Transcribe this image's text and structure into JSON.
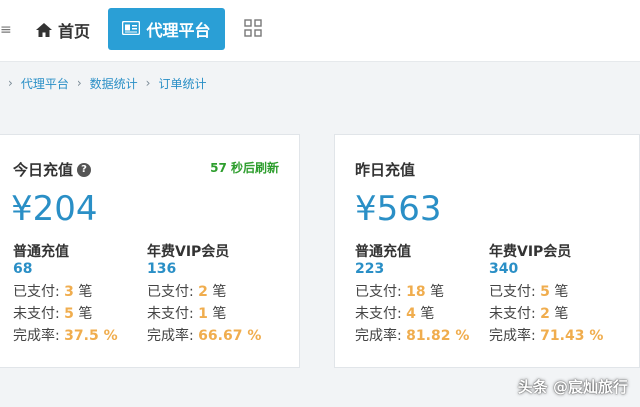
{
  "nav": {
    "home_label": "首页",
    "active_label": "代理平台",
    "edge_glyph": "≡"
  },
  "breadcrumb": {
    "items": [
      "代理平台",
      "数据统计",
      "订单统计"
    ],
    "separator": "›"
  },
  "today": {
    "title": "今日充值",
    "refresh_seconds": "57",
    "refresh_text": "秒后刷新",
    "amount": "¥204",
    "normal": {
      "name": "普通充值",
      "count": "68",
      "paid_label": "已支付: ",
      "paid": "3",
      "paid_unit": " 笔",
      "unpaid_label": "未支付: ",
      "unpaid": "5",
      "unpaid_unit": " 笔",
      "rate_label": "完成率: ",
      "rate": "37.5 %"
    },
    "vip": {
      "name": "年费VIP会员",
      "count": "136",
      "paid_label": "已支付: ",
      "paid": "2",
      "paid_unit": " 笔",
      "unpaid_label": "未支付: ",
      "unpaid": "1",
      "unpaid_unit": " 笔",
      "rate_label": "完成率: ",
      "rate": "66.67 %"
    }
  },
  "yesterday": {
    "title": "昨日充值",
    "amount": "¥563",
    "normal": {
      "name": "普通充值",
      "count": "223",
      "paid_label": "已支付: ",
      "paid": "18",
      "paid_unit": " 笔",
      "unpaid_label": "未支付: ",
      "unpaid": "4",
      "unpaid_unit": " 笔",
      "rate_label": "完成率: ",
      "rate": "81.82 %"
    },
    "vip": {
      "name": "年费VIP会员",
      "count": "340",
      "paid_label": "已支付: ",
      "paid": "5",
      "paid_unit": " 笔",
      "unpaid_label": "未支付: ",
      "unpaid": "2",
      "unpaid_unit": " 笔",
      "rate_label": "完成率: ",
      "rate": "71.43 %"
    }
  },
  "watermark": "头条 @宸灿旅行",
  "colors": {
    "accent": "#2a9fd6",
    "link": "#2a8fc6",
    "highlight": "#f0ad4e",
    "success": "#2e9e2e"
  },
  "icons": {
    "home": "home-icon",
    "platform": "id-card-icon",
    "grid": "grid-icon",
    "help": "help-circle-icon"
  }
}
